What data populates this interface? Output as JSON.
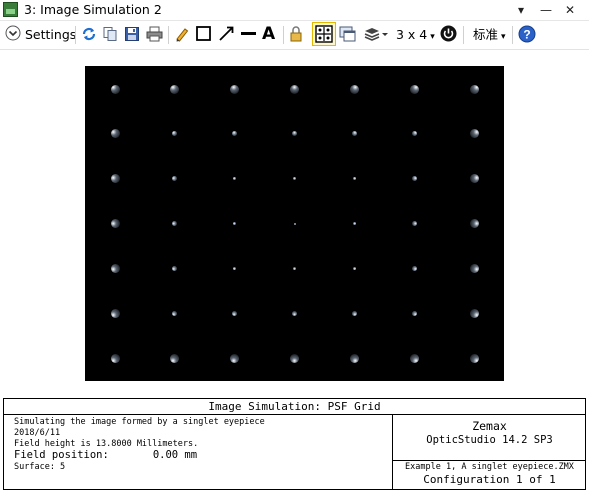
{
  "window": {
    "title": "3: Image Simulation 2"
  },
  "toolbar": {
    "settings_label": "Settings",
    "grid_label": "3 x 4",
    "language_label": "标准"
  },
  "plot": {
    "rows": 7,
    "cols": 7,
    "background": "#000000"
  },
  "footer": {
    "title": "Image Simulation: PSF Grid",
    "line1": "Simulating the image formed by a singlet eyepiece",
    "line2": "2018/6/11",
    "line3": "Field height is 13.8000 Millimeters.",
    "field_label": "Field position:",
    "field_value": "0.00 mm",
    "surface": "Surface: 5",
    "company": "Zemax",
    "product": "OpticStudio 14.2 SP3",
    "file": "Example 1, A singlet eyepiece.ZMX",
    "config": "Configuration 1 of 1"
  }
}
